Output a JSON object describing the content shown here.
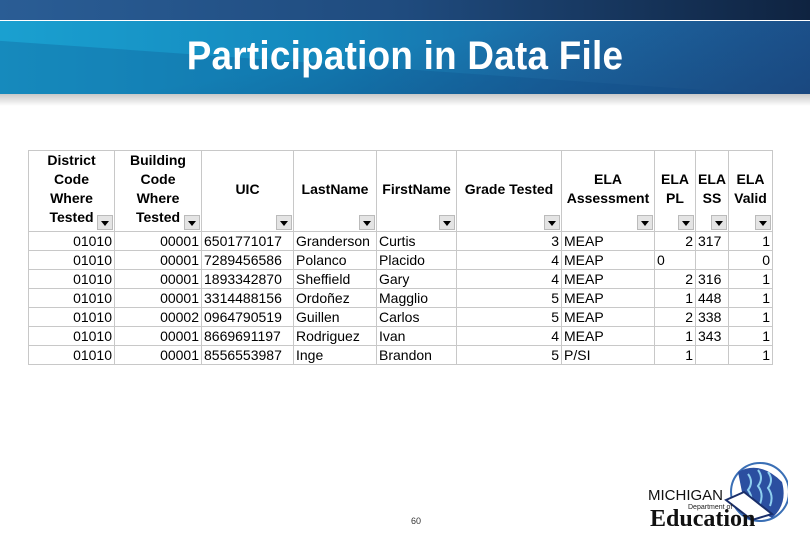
{
  "slide": {
    "title": "Participation in Data File",
    "page_number": "60"
  },
  "table": {
    "headers": [
      {
        "label": "District Code Where Tested",
        "lines": [
          "District",
          "Code",
          "Where",
          "Tested"
        ]
      },
      {
        "label": "Building Code Where Tested",
        "lines": [
          "Building",
          "Code",
          "Where",
          "Tested"
        ]
      },
      {
        "label": "UIC",
        "lines": [
          "UIC"
        ]
      },
      {
        "label": "LastName",
        "lines": [
          "LastName"
        ]
      },
      {
        "label": "FirstName",
        "lines": [
          "FirstName"
        ]
      },
      {
        "label": "Grade Tested",
        "lines": [
          "Grade Tested"
        ]
      },
      {
        "label": "ELA Assessment",
        "lines": [
          "ELA",
          "Assessment"
        ]
      },
      {
        "label": "ELA PL",
        "lines": [
          "ELA",
          "PL"
        ]
      },
      {
        "label": "ELA SS",
        "lines": [
          "ELA",
          "SS"
        ]
      },
      {
        "label": "ELA Valid",
        "lines": [
          "ELA",
          "Valid"
        ]
      }
    ],
    "rows": [
      [
        "01010",
        "00001",
        "6501771017",
        "Granderson",
        "Curtis",
        "3",
        "MEAP",
        "2",
        "317",
        "1"
      ],
      [
        "01010",
        "00001",
        "7289456586",
        "Polanco",
        "Placido",
        "4",
        "MEAP",
        "0",
        "",
        "0"
      ],
      [
        "01010",
        "00001",
        "1893342870",
        "Sheffield",
        "Gary",
        "4",
        "MEAP",
        "2",
        "316",
        "1"
      ],
      [
        "01010",
        "00001",
        "3314488156",
        "Ordoñez",
        "Magglio",
        "5",
        "MEAP",
        "1",
        "448",
        "1"
      ],
      [
        "01010",
        "00002",
        "0964790519",
        "Guillen",
        "Carlos",
        "5",
        "MEAP",
        "2",
        "338",
        "1"
      ],
      [
        "01010",
        "00001",
        "8669691197",
        "Rodriguez",
        "Ivan",
        "4",
        "MEAP",
        "1",
        "343",
        "1"
      ],
      [
        "01010",
        "00001",
        "8556553987",
        "Inge",
        "Brandon",
        "5",
        "P/SI",
        "1",
        "",
        "1"
      ]
    ]
  },
  "logo": {
    "line1": "MICHIGAN",
    "line2": "Department of",
    "line3": "Education"
  }
}
